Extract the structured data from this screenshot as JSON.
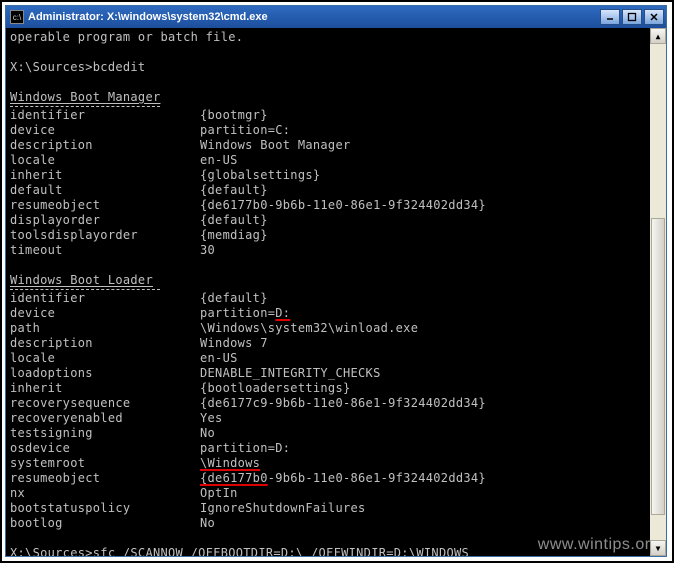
{
  "window": {
    "title": "Administrator: X:\\windows\\system32\\cmd.exe"
  },
  "console": {
    "line_error": "operable program or batch file.",
    "prompt1": "X:\\Sources>",
    "cmd1": "bcdedit",
    "section1": "Windows Boot Manager",
    "kv1": [
      {
        "k": "identifier",
        "v": "{bootmgr}"
      },
      {
        "k": "device",
        "v": "partition=C:"
      },
      {
        "k": "description",
        "v": "Windows Boot Manager"
      },
      {
        "k": "locale",
        "v": "en-US"
      },
      {
        "k": "inherit",
        "v": "{globalsettings}"
      },
      {
        "k": "default",
        "v": "{default}"
      },
      {
        "k": "resumeobject",
        "v": "{de6177b0-9b6b-11e0-86e1-9f324402dd34}"
      },
      {
        "k": "displayorder",
        "v": "{default}"
      },
      {
        "k": "toolsdisplayorder",
        "v": "{memdiag}"
      },
      {
        "k": "timeout",
        "v": "30"
      }
    ],
    "section2": "Windows Boot Loader",
    "kv2a": [
      {
        "k": "identifier",
        "v": "{default}"
      }
    ],
    "kv2_device_k": "device",
    "kv2_device_v1": "partition=",
    "kv2_device_v2": "D:",
    "kv2b": [
      {
        "k": "path",
        "v": "\\Windows\\system32\\winload.exe"
      },
      {
        "k": "description",
        "v": "Windows 7"
      },
      {
        "k": "locale",
        "v": "en-US"
      },
      {
        "k": "loadoptions",
        "v": "DENABLE_INTEGRITY_CHECKS"
      },
      {
        "k": "inherit",
        "v": "{bootloadersettings}"
      },
      {
        "k": "recoverysequence",
        "v": "{de6177c9-9b6b-11e0-86e1-9f324402dd34}"
      },
      {
        "k": "recoveryenabled",
        "v": "Yes"
      },
      {
        "k": "testsigning",
        "v": "No"
      },
      {
        "k": "osdevice",
        "v": "partition=D:"
      }
    ],
    "kv2_sysroot_k": "systemroot",
    "kv2_sysroot_v": "\\Windows",
    "kv2_resume_k": "resumeobject",
    "kv2_resume_v1": "{de6177b0",
    "kv2_resume_v2": "-9b6b-11e0-86e1-9f324402dd34}",
    "kv2c": [
      {
        "k": "nx",
        "v": "OptIn"
      },
      {
        "k": "bootstatuspolicy",
        "v": "IgnoreShutdownFailures"
      },
      {
        "k": "bootlog",
        "v": "No"
      }
    ],
    "prompt2": "X:\\Sources>",
    "cmd2_p1": "sfc /SCANNOW /OFFBOOTDIR=",
    "cmd2_hl1": "D:\\",
    "cmd2_p2": " /OFFWINDIR=",
    "cmd2_hl2": "D:",
    "cmd2_p3": "\\WINDOWS"
  },
  "watermark": "www.wintips.org"
}
